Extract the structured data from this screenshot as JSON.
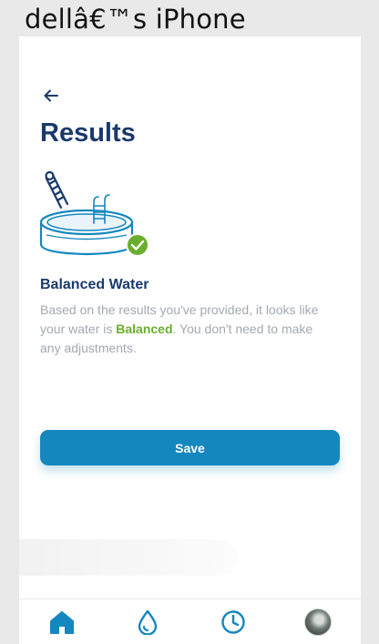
{
  "device": {
    "title": "dellâ€™s iPhone"
  },
  "header": {
    "back_icon": "arrow-left-icon",
    "title": "Results"
  },
  "illustration": {
    "icon": "pool-icon",
    "badge_icon": "check-circle-icon"
  },
  "result": {
    "title": "Balanced Water",
    "desc_prefix": "Based on the results you've provided, it looks like your water is ",
    "desc_highlight": "Balanced",
    "desc_suffix": ". You don't need to make any adjustments."
  },
  "actions": {
    "save_label": "Save"
  },
  "tab_bar": {
    "items": [
      {
        "icon": "home-icon",
        "active": true
      },
      {
        "icon": "water-drop-icon",
        "active": false
      },
      {
        "icon": "clock-icon",
        "active": false
      },
      {
        "icon": "profile-avatar",
        "active": false
      }
    ]
  },
  "colors": {
    "primary": "#1487bf",
    "heading": "#1a3a6b",
    "success": "#6aae2e",
    "muted_text": "#a3a9b1"
  }
}
